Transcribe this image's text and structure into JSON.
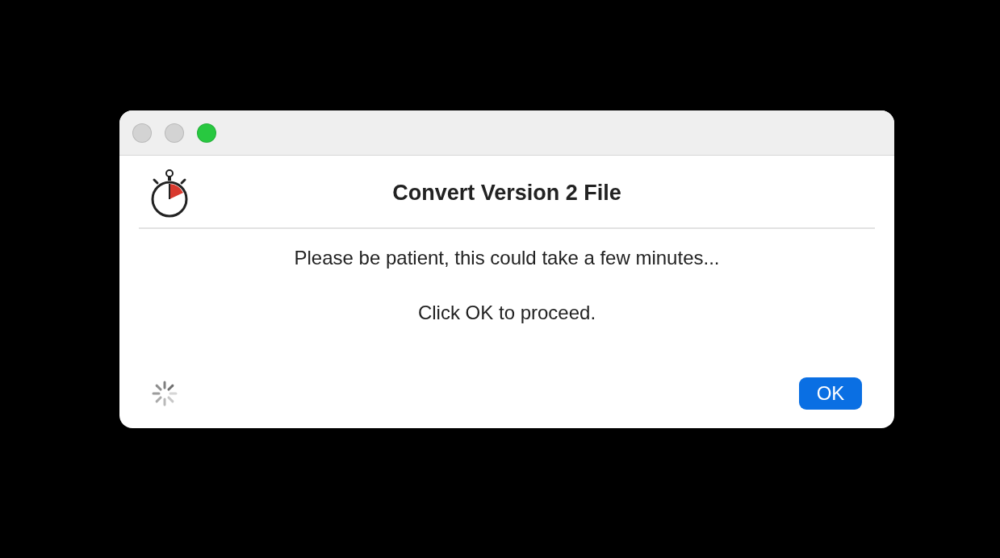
{
  "window": {
    "controls": [
      {
        "kind": "close",
        "disabled": true
      },
      {
        "kind": "minimize",
        "disabled": true
      },
      {
        "kind": "zoom",
        "disabled": false
      }
    ]
  },
  "dialog": {
    "title": "Convert Version 2 File",
    "message": "Please be patient, this could take a few minutes...",
    "instruction": "Click OK to proceed.",
    "buttons": [
      "OK"
    ]
  }
}
